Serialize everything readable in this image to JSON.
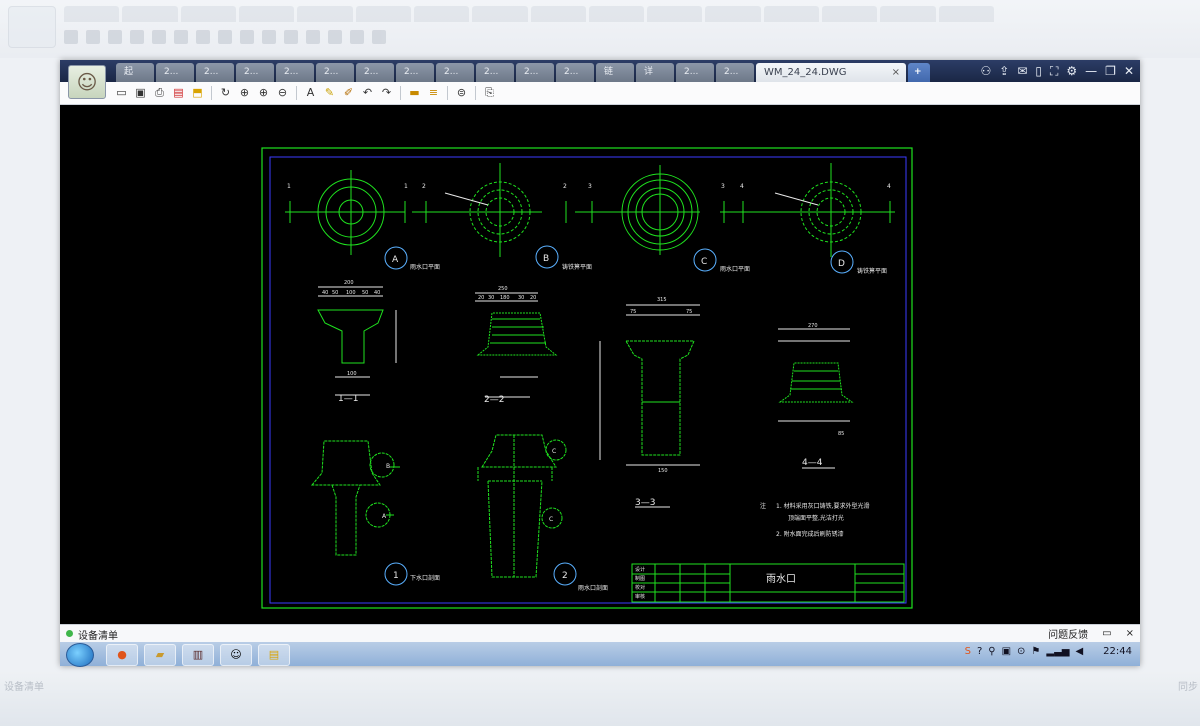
{
  "background": {
    "status_label": "设备清单",
    "status_right": "同步"
  },
  "window": {
    "tabs": [
      "起",
      "2...",
      "2...",
      "2...",
      "2...",
      "2...",
      "2...",
      "2...",
      "2...",
      "2...",
      "2...",
      "2...",
      "链",
      "详",
      "2...",
      "2..."
    ],
    "active_tab": "WM_24_24.DWG",
    "active_tab_close": "×",
    "new_tab": "+",
    "title_icons": [
      "share-icon",
      "export-icon",
      "weixin-icon",
      "phone-icon",
      "fullscreen-icon",
      "settings-icon",
      "minimize-icon",
      "restore-icon",
      "close-icon"
    ],
    "toolbar_icons": [
      "open-icon",
      "save-icon",
      "print-icon",
      "pdf-icon",
      "lock-icon",
      "rotate-icon",
      "zoom-window-icon",
      "zoom-in-icon",
      "zoom-out-icon",
      "text-icon",
      "pen-icon",
      "highlight-icon",
      "undo-icon",
      "redo-icon",
      "layer-icon",
      "layers-icon",
      "stack-icon",
      "export-icon"
    ]
  },
  "drawing": {
    "plan_labels": {
      "A": "A",
      "B": "B",
      "C": "C",
      "D": "D"
    },
    "plan_captions": [
      "雨水口平面",
      "铸铁箅平面",
      "雨水口平面",
      "铸铁箅平面"
    ],
    "axis_numbers": [
      "1",
      "1",
      "2",
      "2",
      "3",
      "3",
      "4",
      "4"
    ],
    "section_titles": [
      "1—1",
      "2—2",
      "3—3",
      "4—4"
    ],
    "detail_labels": [
      "1",
      "2"
    ],
    "detail_captions": [
      "下水口剖面",
      "雨水口剖面"
    ],
    "notes": {
      "prefix": "注",
      "lines": [
        "1.  材料采用灰口铸铁,要求外型光滑",
        "顶端面平整,光洁打光",
        "2.  附水面完成后刷防锈漆"
      ]
    },
    "titleblock": {
      "title": "雨水口",
      "cells": [
        "设计",
        "制图",
        "校对",
        "审核"
      ]
    },
    "dims": [
      "200",
      "250",
      "315",
      "270",
      "40",
      "50",
      "100",
      "50",
      "40",
      "20",
      "30",
      "180",
      "30",
      "20",
      "75",
      "150",
      "75",
      "100",
      "85"
    ],
    "callouts": [
      "B",
      "C",
      "A",
      "C"
    ]
  },
  "status": {
    "label": "设备清单",
    "right_label": "问题反馈",
    "comment_icon": "comment-icon",
    "close_icon": "×"
  },
  "taskbar": {
    "clock": "22:44",
    "buttons": [
      "firefox",
      "folder",
      "books",
      "avatar",
      "chart"
    ]
  }
}
